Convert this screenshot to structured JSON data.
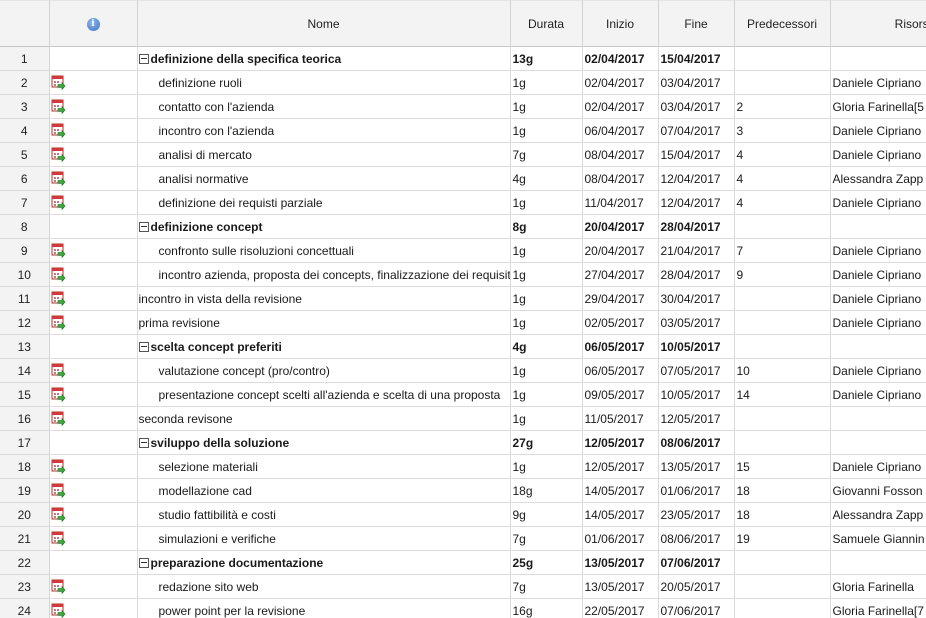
{
  "header": {
    "num": "",
    "indicators": "info-icon",
    "nome": "Nome",
    "durata": "Durata",
    "inizio": "Inizio",
    "fine": "Fine",
    "predecessori": "Predecessori",
    "risorse": "Risorse"
  },
  "rows": [
    {
      "id": "1",
      "name": "definizione della specifica teorica",
      "durata": "13g",
      "inizio": "02/04/2017",
      "fine": "15/04/2017",
      "pred": "",
      "risorse": "",
      "summary": true,
      "level": 0,
      "icon": false
    },
    {
      "id": "2",
      "name": "definizione ruoli",
      "durata": "1g",
      "inizio": "02/04/2017",
      "fine": "03/04/2017",
      "pred": "",
      "risorse": "Daniele Cipriano",
      "summary": false,
      "level": 1,
      "icon": true
    },
    {
      "id": "3",
      "name": "contatto con l'azienda",
      "durata": "1g",
      "inizio": "02/04/2017",
      "fine": "03/04/2017",
      "pred": "2",
      "risorse": "Gloria Farinella[5",
      "summary": false,
      "level": 1,
      "icon": true
    },
    {
      "id": "4",
      "name": "incontro con l'azienda",
      "durata": "1g",
      "inizio": "06/04/2017",
      "fine": "07/04/2017",
      "pred": "3",
      "risorse": "Daniele Cipriano",
      "summary": false,
      "level": 1,
      "icon": true
    },
    {
      "id": "5",
      "name": "analisi di mercato",
      "durata": "7g",
      "inizio": "08/04/2017",
      "fine": "15/04/2017",
      "pred": "4",
      "risorse": "Daniele Cipriano",
      "summary": false,
      "level": 1,
      "icon": true
    },
    {
      "id": "6",
      "name": "analisi normative",
      "durata": "4g",
      "inizio": "08/04/2017",
      "fine": "12/04/2017",
      "pred": "4",
      "risorse": "Alessandra Zapp",
      "summary": false,
      "level": 1,
      "icon": true
    },
    {
      "id": "7",
      "name": "definizione dei requisti parziale",
      "durata": "1g",
      "inizio": "11/04/2017",
      "fine": "12/04/2017",
      "pred": "4",
      "risorse": "Daniele Cipriano",
      "summary": false,
      "level": 1,
      "icon": true
    },
    {
      "id": "8",
      "name": "definizione concept",
      "durata": "8g",
      "inizio": "20/04/2017",
      "fine": "28/04/2017",
      "pred": "",
      "risorse": "",
      "summary": true,
      "level": 0,
      "icon": false
    },
    {
      "id": "9",
      "name": "confronto sulle risoluzioni concettuali",
      "durata": "1g",
      "inizio": "20/04/2017",
      "fine": "21/04/2017",
      "pred": "7",
      "risorse": "Daniele Cipriano",
      "summary": false,
      "level": 1,
      "icon": true
    },
    {
      "id": "10",
      "name": "incontro azienda, proposta dei concepts, finalizzazione dei requisiti",
      "durata": "1g",
      "inizio": "27/04/2017",
      "fine": "28/04/2017",
      "pred": "9",
      "risorse": "Daniele Cipriano",
      "summary": false,
      "level": 1,
      "icon": true
    },
    {
      "id": "11",
      "name": "incontro in vista della revisione",
      "durata": "1g",
      "inizio": "29/04/2017",
      "fine": "30/04/2017",
      "pred": "",
      "risorse": "Daniele Cipriano",
      "summary": false,
      "level": 0,
      "icon": true
    },
    {
      "id": "12",
      "name": "prima revisione",
      "durata": "1g",
      "inizio": "02/05/2017",
      "fine": "03/05/2017",
      "pred": "",
      "risorse": "Daniele Cipriano",
      "summary": false,
      "level": 0,
      "icon": true
    },
    {
      "id": "13",
      "name": "scelta concept preferiti",
      "durata": "4g",
      "inizio": "06/05/2017",
      "fine": "10/05/2017",
      "pred": "",
      "risorse": "",
      "summary": true,
      "level": 0,
      "icon": false
    },
    {
      "id": "14",
      "name": "valutazione concept (pro/contro)",
      "durata": "1g",
      "inizio": "06/05/2017",
      "fine": "07/05/2017",
      "pred": "10",
      "risorse": "Daniele Cipriano",
      "summary": false,
      "level": 1,
      "icon": true
    },
    {
      "id": "15",
      "name": "presentazione concept scelti all'azienda e scelta di una proposta",
      "durata": "1g",
      "inizio": "09/05/2017",
      "fine": "10/05/2017",
      "pred": "14",
      "risorse": "Daniele Cipriano",
      "summary": false,
      "level": 1,
      "icon": true
    },
    {
      "id": "16",
      "name": "seconda revisone",
      "durata": "1g",
      "inizio": "11/05/2017",
      "fine": "12/05/2017",
      "pred": "",
      "risorse": "",
      "summary": false,
      "level": 0,
      "icon": true
    },
    {
      "id": "17",
      "name": "sviluppo della soluzione",
      "durata": "27g",
      "inizio": "12/05/2017",
      "fine": "08/06/2017",
      "pred": "",
      "risorse": "",
      "summary": true,
      "level": 0,
      "icon": false
    },
    {
      "id": "18",
      "name": "selezione materiali",
      "durata": "1g",
      "inizio": "12/05/2017",
      "fine": "13/05/2017",
      "pred": "15",
      "risorse": "Daniele Cipriano",
      "summary": false,
      "level": 1,
      "icon": true
    },
    {
      "id": "19",
      "name": "modellazione cad",
      "durata": "18g",
      "inizio": "14/05/2017",
      "fine": "01/06/2017",
      "pred": "18",
      "risorse": "Giovanni Fosson",
      "summary": false,
      "level": 1,
      "icon": true
    },
    {
      "id": "20",
      "name": "studio fattibilità e costi",
      "durata": "9g",
      "inizio": "14/05/2017",
      "fine": "23/05/2017",
      "pred": "18",
      "risorse": "Alessandra Zapp",
      "summary": false,
      "level": 1,
      "icon": true
    },
    {
      "id": "21",
      "name": "simulazioni e verifiche",
      "durata": "7g",
      "inizio": "01/06/2017",
      "fine": "08/06/2017",
      "pred": "19",
      "risorse": "Samuele Giannin",
      "summary": false,
      "level": 1,
      "icon": true
    },
    {
      "id": "22",
      "name": "preparazione documentazione",
      "durata": "25g",
      "inizio": "13/05/2017",
      "fine": "07/06/2017",
      "pred": "",
      "risorse": "",
      "summary": true,
      "level": 0,
      "icon": false
    },
    {
      "id": "23",
      "name": "redazione sito web",
      "durata": "7g",
      "inizio": "13/05/2017",
      "fine": "20/05/2017",
      "pred": "",
      "risorse": "Gloria Farinella",
      "summary": false,
      "level": 1,
      "icon": true
    },
    {
      "id": "24",
      "name": "power point per la revisione",
      "durata": "16g",
      "inizio": "22/05/2017",
      "fine": "07/06/2017",
      "pred": "",
      "risorse": "Gloria Farinella[7",
      "summary": false,
      "level": 1,
      "icon": true
    }
  ]
}
